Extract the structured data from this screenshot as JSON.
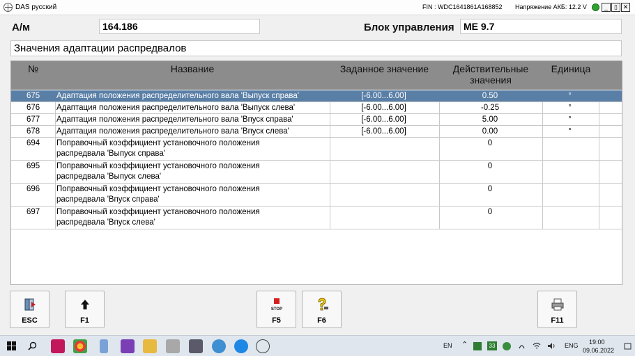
{
  "window": {
    "title": "DAS русский",
    "fin": "FIN : WDC1641861A168852",
    "voltage": "Напряжение АКБ: 12.2 V",
    "min_label": "_",
    "max_label": "▯",
    "close_label": "✕"
  },
  "header": {
    "am_label": "А/м",
    "am_value": "164.186",
    "ecu_label": "Блок управления",
    "ecu_value": "ME 9.7",
    "section_title": "Значения адаптации распредвалов"
  },
  "table": {
    "columns": [
      "№",
      "Название",
      "Заданное значение",
      "Действительные значения",
      "Единица"
    ],
    "rows": [
      {
        "no": "675",
        "name": "Адаптация положения распределительного вала 'Выпуск справа'",
        "target": "[-6.00...6.00]",
        "actual": "0.50",
        "unit": "°",
        "selected": true
      },
      {
        "no": "676",
        "name": "Адаптация положения распределительного вала 'Выпуск слева'",
        "target": "[-6.00...6.00]",
        "actual": "-0.25",
        "unit": "°",
        "selected": false
      },
      {
        "no": "677",
        "name": "Адаптация положения распределительного вала 'Впуск справа'",
        "target": "[-6.00...6.00]",
        "actual": "5.00",
        "unit": "°",
        "selected": false
      },
      {
        "no": "678",
        "name": "Адаптация положения распределительного вала 'Впуск слева'",
        "target": "[-6.00...6.00]",
        "actual": "0.00",
        "unit": "°",
        "selected": false
      },
      {
        "no": "694",
        "name": "Поправочный коэффициент установочного положения распредвала 'Выпуск справа'",
        "target": "",
        "actual": "0",
        "unit": "",
        "selected": false
      },
      {
        "no": "695",
        "name": "Поправочный коэффициент установочного положения распредвала 'Выпуск слева'",
        "target": "",
        "actual": "0",
        "unit": "",
        "selected": false
      },
      {
        "no": "696",
        "name": "Поправочный коэффициент установочного положения распредвала 'Впуск справа'",
        "target": "",
        "actual": "0",
        "unit": "",
        "selected": false
      },
      {
        "no": "697",
        "name": "Поправочный коэффициент установочного положения распредвала 'Впуск слева'",
        "target": "",
        "actual": "0",
        "unit": "",
        "selected": false
      }
    ]
  },
  "buttons": {
    "esc": "ESC",
    "f1": "F1",
    "stop_text": "STOP",
    "f5": "F5",
    "f6": "F6",
    "f11": "F11"
  },
  "taskbar": {
    "lang_en": "EN",
    "lang_eng": "ENG",
    "time": "19:00",
    "date": "09.06.2022",
    "badge_num": "33"
  },
  "colors": {
    "selected_row": "#5a7fa6",
    "header_bg": "#8c8c8c",
    "voltage_ok": "#2fa32f"
  }
}
